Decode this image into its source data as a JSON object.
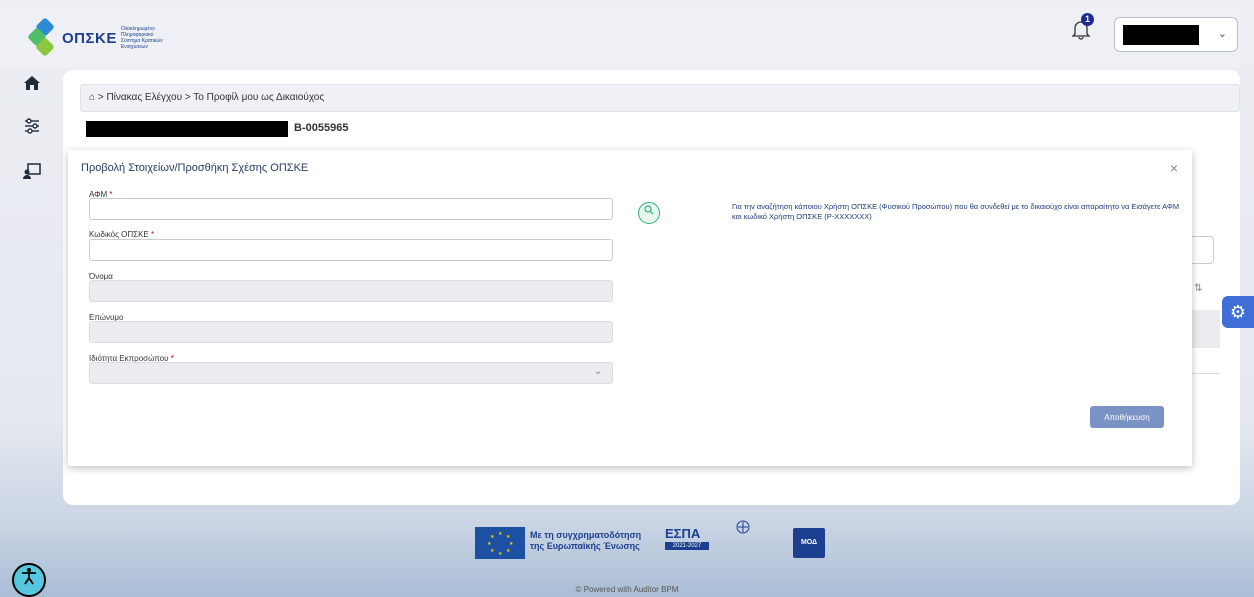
{
  "brand": {
    "logo_text": "ΟΠΣΚΕ",
    "logo_subtext": "Ολοκληρωμένο Πληροφοριακό Σύστημα Κρατικών Ενισχύσεων",
    "colors": {
      "primary": "#1d3f8f",
      "green": "#2fae74",
      "accent": "#3f6fd6"
    }
  },
  "header": {
    "notification_count": "1",
    "user_name_redacted": true
  },
  "breadcrumb": {
    "home_icon": "home-icon",
    "text": "> Πίνακας Ελέγχου > Το Προφίλ μου ως Δικαιούχος"
  },
  "page": {
    "title_code": "Β-0055965"
  },
  "modal": {
    "title": "Προβολή Στοιχείων/Προσθήκη Σχέσης ΟΠΣΚΕ",
    "close_label": "×",
    "fields": {
      "afm": {
        "label": "ΑΦΜ",
        "required": "*",
        "value": ""
      },
      "opske_code": {
        "label": "Κωδικός ΟΠΣΚΕ",
        "required": "*",
        "value": ""
      },
      "first_name": {
        "label": "Όνομα",
        "value": ""
      },
      "last_name": {
        "label": "Επώνυμο",
        "value": ""
      },
      "representative_role": {
        "label": "Ιδιότητα Εκπροσώπου",
        "required": "*",
        "value": ""
      }
    },
    "help_text": "Για την αναζήτηση κάποιου Χρήστη ΟΠΣΚΕ (Φυσικού Προσώπου) που θα συνδεθεί με το δικαιούχο είναι απαραίτητο να Εισάγετε ΑΦΜ και κωδικό Χρήστη ΟΠΣΚΕ (Ρ-ΧΧΧΧΧΧΧ)",
    "save_label": "Αποθήκευση"
  },
  "footer": {
    "eu_text_line1": "Με τη συγχρηματοδότηση",
    "eu_text_line2": "της Ευρωπαϊκής Ένωσης",
    "espa_title": "ΕΣΠΑ",
    "espa_period": "2021-2027",
    "moa_label": "ΜΟΔ",
    "powered_by": "© Powered with Auditor BPM"
  }
}
